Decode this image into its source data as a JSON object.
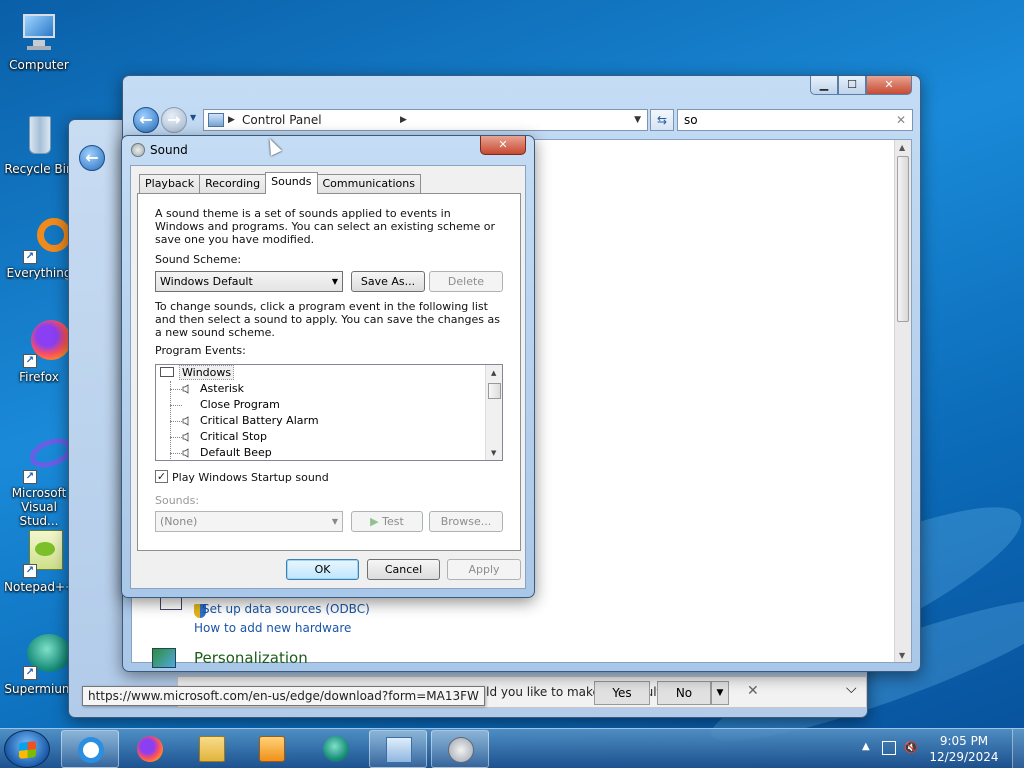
{
  "desktop": {
    "icons": [
      {
        "label": "Computer",
        "icon": "computer-icon"
      },
      {
        "label": "Recycle Bin",
        "icon": "recycle-bin-icon"
      },
      {
        "label": "Everything",
        "icon": "everything-icon"
      },
      {
        "label": "Firefox",
        "icon": "firefox-icon"
      },
      {
        "label": "Microsoft Visual Stud...",
        "icon": "visual-studio-icon"
      },
      {
        "label": "Notepad++",
        "icon": "notepad-plus-plus-icon"
      },
      {
        "label": "Supermium",
        "icon": "supermium-icon"
      }
    ]
  },
  "control_panel": {
    "breadcrumb": "Control Panel",
    "search_value": "so",
    "links": {
      "odbc": "Set up data sources (ODBC)",
      "hardware": "How to add new hardware",
      "personalization": "Personalization"
    }
  },
  "browser_prompt": {
    "question": "Would you like to make ... default browser?",
    "yes": "Yes",
    "no": "No",
    "tooltip": "https://www.microsoft.com/en-us/edge/download?form=MA13FW"
  },
  "sound_dialog": {
    "title": "Sound",
    "tabs": [
      "Playback",
      "Recording",
      "Sounds",
      "Communications"
    ],
    "active_tab": "Sounds",
    "intro": "A sound theme is a set of sounds applied to events in Windows and programs.  You can select an existing scheme or save one you have modified.",
    "scheme_label": "Sound Scheme:",
    "scheme_value": "Windows Default",
    "save_as": "Save As...",
    "delete": "Delete",
    "instructions": "To change sounds, click a program event in the following list and then select a sound to apply.  You can save the changes as a new sound scheme.",
    "events_label": "Program Events:",
    "events_root": "Windows",
    "events": [
      {
        "name": "Asterisk",
        "has_sound": true
      },
      {
        "name": "Close Program",
        "has_sound": false
      },
      {
        "name": "Critical Battery Alarm",
        "has_sound": true
      },
      {
        "name": "Critical Stop",
        "has_sound": true
      },
      {
        "name": "Default Beep",
        "has_sound": true
      }
    ],
    "startup_checkbox_label": "Play Windows Startup sound",
    "startup_checked": true,
    "sounds_label": "Sounds:",
    "sounds_value": "(None)",
    "test": "Test",
    "browse": "Browse...",
    "ok": "OK",
    "cancel": "Cancel",
    "apply": "Apply"
  },
  "taskbar": {
    "apps": [
      "internet-explorer-icon",
      "firefox-icon",
      "file-explorer-icon",
      "media-player-icon",
      "supermium-icon",
      "control-panel-icon",
      "sound-icon"
    ],
    "time": "9:05 PM",
    "date": "12/29/2024"
  },
  "colors": {
    "accent": "#1a56a8",
    "title_bar": "#a9c7e8",
    "close_button": "#c74a32"
  }
}
